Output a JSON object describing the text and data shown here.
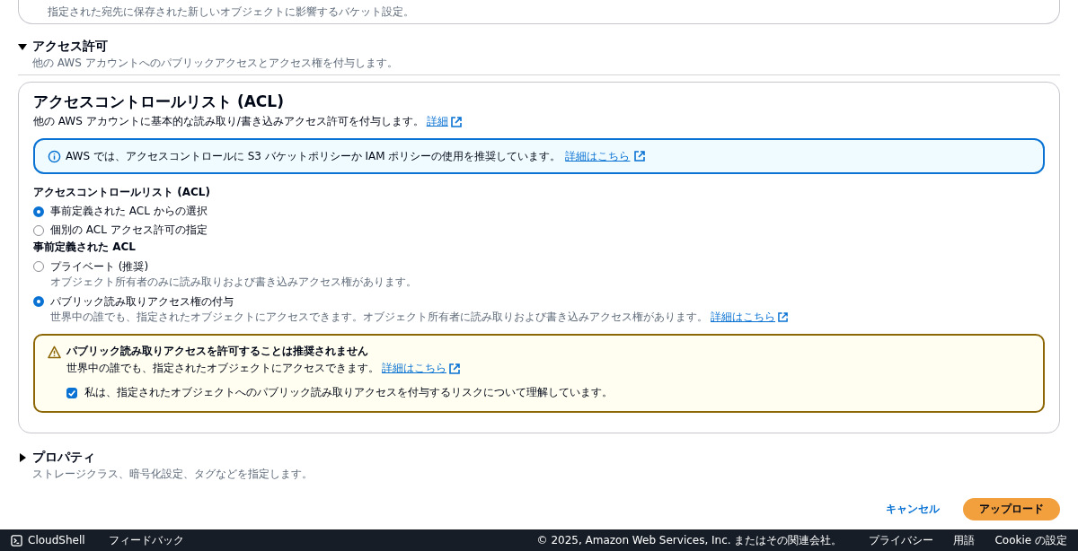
{
  "top_card": {
    "description": "指定された宛先に保存された新しいオブジェクトに影響するバケット設定。"
  },
  "permissions": {
    "title": "アクセス許可",
    "description": "他の AWS アカウントへのパブリックアクセスとアクセス権を付与します。",
    "expanded": true
  },
  "acl": {
    "title": "アクセスコントロールリスト (ACL)",
    "description": "他の AWS アカウントに基本的な読み取り/書き込みアクセス許可を付与します。",
    "link": "詳細",
    "info": {
      "text": "AWS では、アクセスコントロールに S3 バケットポリシーか IAM ポリシーの使用を推奨しています。",
      "link": "詳細はこちら"
    },
    "group_label": "アクセスコントロールリスト (ACL)",
    "modes": [
      {
        "label": "事前定義された ACL からの選択",
        "selected": true
      },
      {
        "label": "個別の ACL アクセス許可の指定",
        "selected": false
      }
    ],
    "predefined_label": "事前定義された ACL",
    "predefined": [
      {
        "label": "プライベート (推奨)",
        "description": "オブジェクト所有者のみに読み取りおよび書き込みアクセス権があります。",
        "selected": false
      },
      {
        "label": "パブリック読み取りアクセス権の付与",
        "description": "世界中の誰でも、指定されたオブジェクトにアクセスできます。オブジェクト所有者に読み取りおよび書き込みアクセス権があります。",
        "link": "詳細はこちら",
        "selected": true
      }
    ],
    "warning": {
      "title": "パブリック読み取りアクセスを許可することは推奨されません",
      "text": "世界中の誰でも、指定されたオブジェクトにアクセスできます。",
      "link": "詳細はこちら",
      "acknowledge": {
        "label": "私は、指定されたオブジェクトへのパブリック読み取りアクセスを付与するリスクについて理解しています。",
        "checked": true
      }
    }
  },
  "properties": {
    "title": "プロパティ",
    "description": "ストレージクラス、暗号化設定、タグなどを指定します。",
    "expanded": false
  },
  "actions": {
    "cancel": "キャンセル",
    "upload": "アップロード"
  },
  "footer": {
    "cloudshell": "CloudShell",
    "feedback": "フィードバック",
    "copyright": "© 2025, Amazon Web Services, Inc. またはその関連会社。",
    "links": [
      "プライバシー",
      "用語",
      "Cookie の設定"
    ]
  }
}
